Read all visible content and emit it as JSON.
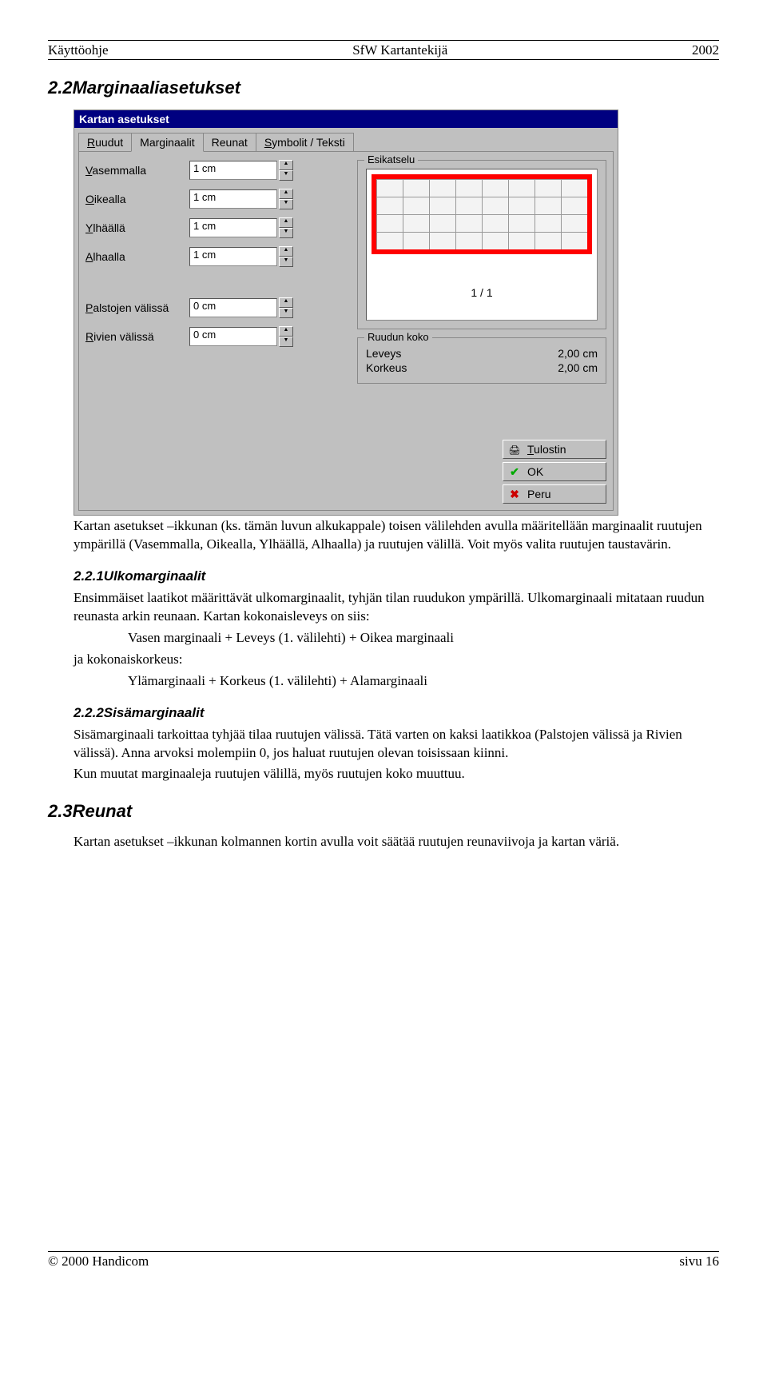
{
  "header": {
    "left": "Käyttöohje",
    "center": "SfW Kartantekijä",
    "right": "2002"
  },
  "section22_title": "2.2Marginaaliasetukset",
  "dialog": {
    "title": "Kartan asetukset",
    "tabs": {
      "ruudut": "Ruudut",
      "marginaalit": "Marginaalit",
      "reunat": "Reunat",
      "symbolit": "Symbolit / Teksti"
    },
    "fields": {
      "vasemmalla": {
        "label_u": "V",
        "label_rest": "asemmalla",
        "value": "1 cm"
      },
      "oikealla": {
        "label_u": "O",
        "label_rest": "ikealla",
        "value": "1 cm"
      },
      "ylhaalla": {
        "label_u": "Y",
        "label_rest": "lhäällä",
        "value": "1 cm"
      },
      "alhaalla": {
        "label_u": "A",
        "label_rest": "lhaalla",
        "value": "1 cm"
      },
      "palstojen": {
        "label_u": "P",
        "label_rest": "alstojen välissä",
        "value": "0 cm"
      },
      "rivien": {
        "label_u": "R",
        "label_rest": "ivien välissä",
        "value": "0 cm"
      }
    },
    "preview": {
      "legend": "Esikatselu",
      "page_indicator": "1 / 1"
    },
    "ruudun": {
      "legend": "Ruudun koko",
      "leveys_label": "Leveys",
      "leveys_value": "2,00 cm",
      "korkeus_label": "Korkeus",
      "korkeus_value": "2,00 cm"
    },
    "buttons": {
      "tulostin_u": "T",
      "tulostin_rest": "ulostin",
      "ok": "OK",
      "peru_u": "",
      "peru_rest": "Peru"
    }
  },
  "para_intro1": "Kartan asetukset –ikkunan (ks. tämän luvun alkukappale) toisen välilehden avulla määritellään marginaalit ruutujen ympärillä (Vasemmalla, Oikealla, Ylhäällä, Alhaalla) ja ruutujen välillä. Voit myös valita ruutujen taustavärin.",
  "sub221": "2.2.1Ulkomarginaalit",
  "para221a": "Ensimmäiset laatikot määrittävät ulkomarginaalit, tyhjän tilan ruudukon ympärillä. Ulkomarginaali mitataan ruudun reunasta arkin reunaan. Kartan kokonaisleveys on siis:",
  "para221b": "Vasen marginaali + Leveys (1. välilehti) + Oikea marginaali",
  "para221c": "ja kokonaiskorkeus:",
  "para221d": "Ylämarginaali + Korkeus (1. välilehti) + Alamarginaali",
  "sub222": "2.2.2Sisämarginaalit",
  "para222a": "Sisämarginaali tarkoittaa tyhjää tilaa ruutujen välissä. Tätä varten on kaksi laatikkoa (Palstojen välissä ja Rivien välissä). Anna arvoksi molempiin 0, jos haluat ruutujen olevan toisissaan kiinni.",
  "para222b": "Kun muutat marginaaleja ruutujen välillä, myös ruutujen koko muuttuu.",
  "section23_title": "2.3Reunat",
  "para23": "Kartan asetukset –ikkunan kolmannen kortin avulla voit säätää ruutujen reunaviivoja ja kartan väriä.",
  "footer": {
    "left": "© 2000 Handicom",
    "right": "sivu 16"
  }
}
